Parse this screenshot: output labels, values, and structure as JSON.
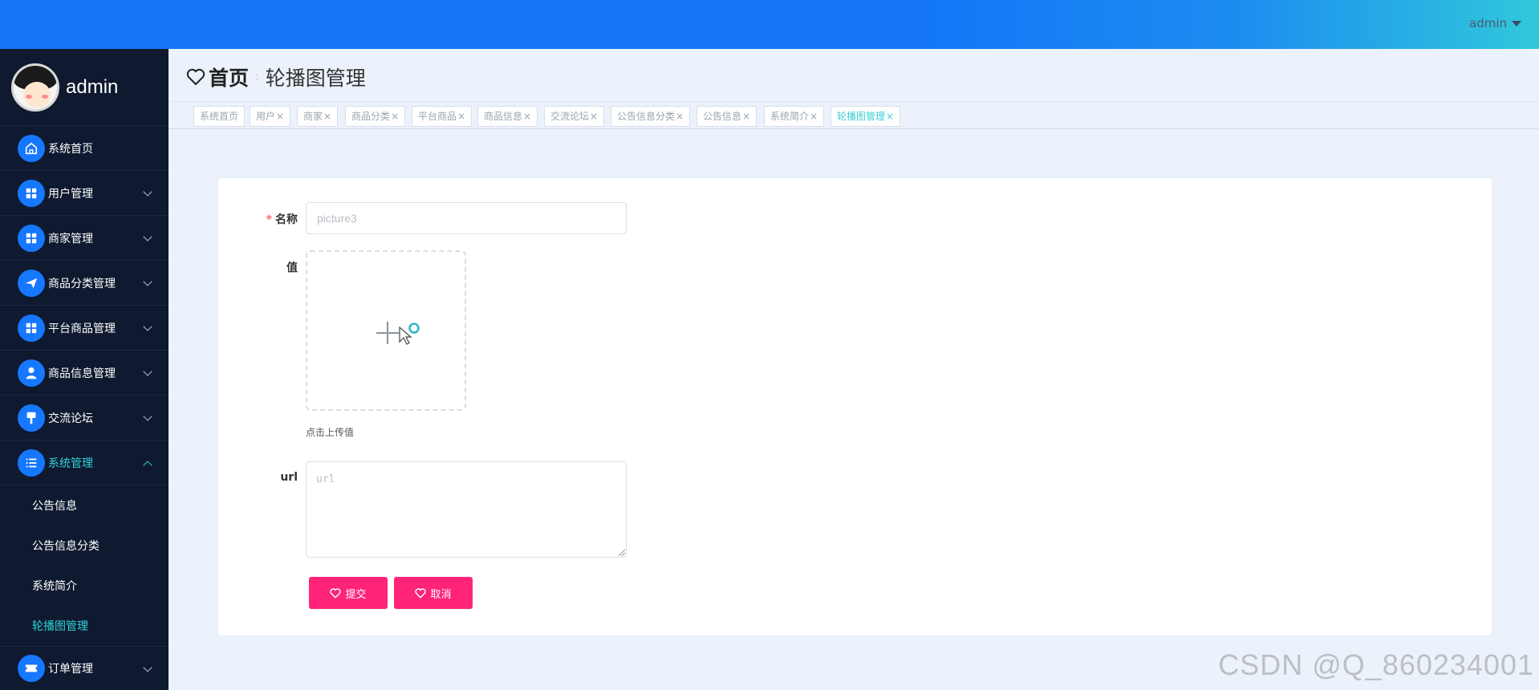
{
  "header": {
    "username": "admin"
  },
  "sidebar": {
    "profile_name": "admin",
    "items": [
      {
        "label": "系统首页",
        "icon": "home-icon",
        "expandable": false
      },
      {
        "label": "用户管理",
        "icon": "grid-icon",
        "expandable": true
      },
      {
        "label": "商家管理",
        "icon": "grid-icon",
        "expandable": true
      },
      {
        "label": "商品分类管理",
        "icon": "send-icon",
        "expandable": true
      },
      {
        "label": "平台商品管理",
        "icon": "grid-icon",
        "expandable": true
      },
      {
        "label": "商品信息管理",
        "icon": "user-icon",
        "expandable": true
      },
      {
        "label": "交流论坛",
        "icon": "brush-icon",
        "expandable": true
      },
      {
        "label": "系统管理",
        "icon": "list-icon",
        "expandable": true,
        "open": true
      },
      {
        "label": "订单管理",
        "icon": "ticket-icon",
        "expandable": true
      }
    ],
    "subitems": [
      "公告信息",
      "公告信息分类",
      "系统简介",
      "轮播图管理"
    ],
    "active_subitem": "轮播图管理"
  },
  "breadcrumb": {
    "home": "首页",
    "separator": ":",
    "current": "轮播图管理"
  },
  "tags": [
    "系统首页",
    "用户",
    "商家",
    "商品分类",
    "平台商品",
    "商品信息",
    "交流论坛",
    "公告信息分类",
    "公告信息",
    "系统简介",
    "轮播图管理"
  ],
  "tag_close": "×",
  "active_tag": "轮播图管理",
  "form": {
    "name_label": "名称",
    "required_mark": "*",
    "name_value": "picture3",
    "value_label": "值",
    "upload_tip": "点击上传值",
    "url_label": "url",
    "url_placeholder": "url",
    "submit_label": "提交",
    "cancel_label": "取消"
  },
  "colors": {
    "accent": "#1677ff",
    "button": "#ff2478",
    "active_menu": "#2fd3d8",
    "sidebar_bg": "#0f1a30"
  },
  "watermark": "CSDN @Q_860234001"
}
